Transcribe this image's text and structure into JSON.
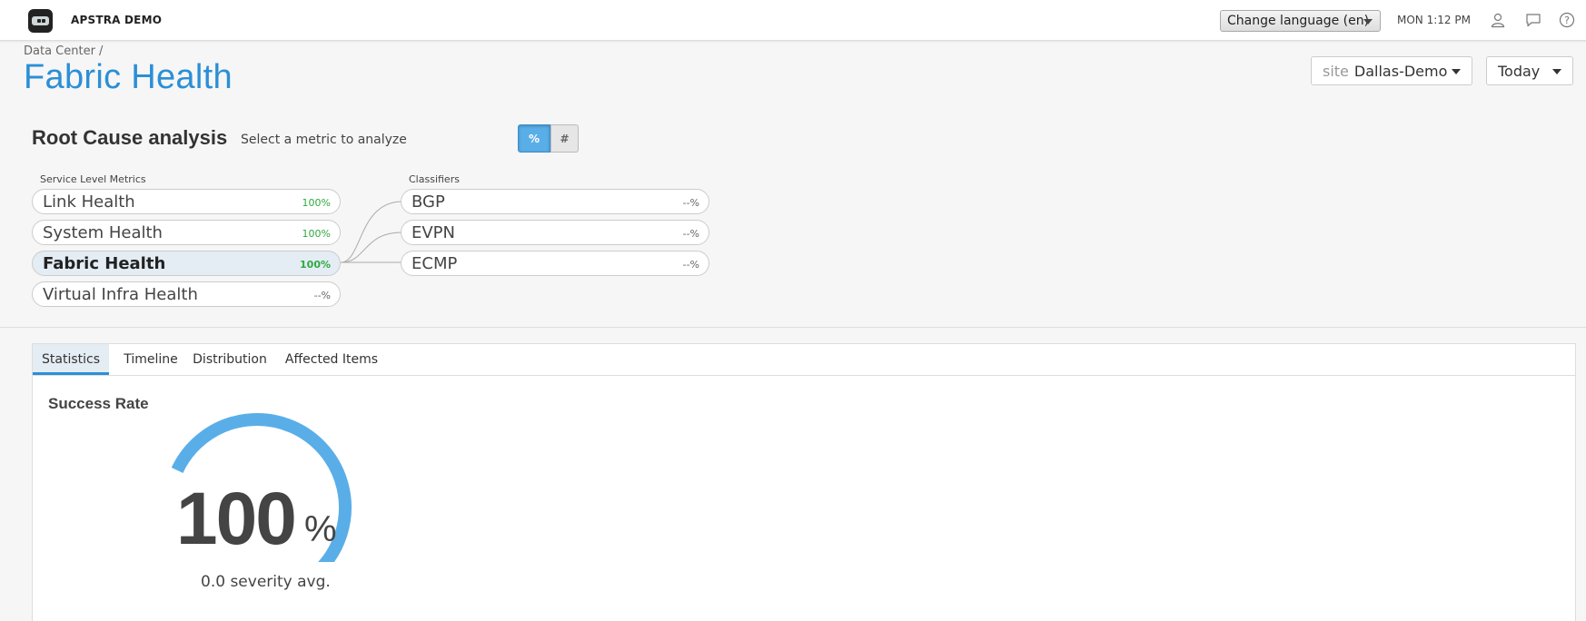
{
  "app": {
    "title": "APSTRA DEMO"
  },
  "topbar": {
    "language_select": "Change language (en)",
    "clock": "MON 1:12 PM",
    "icons": [
      "user-icon",
      "chat-icon",
      "help-icon"
    ]
  },
  "breadcrumb": "Data Center /",
  "page_title": "Fabric Health",
  "filters": {
    "site_label": "site",
    "site_value": "Dallas-Demo",
    "period": "Today"
  },
  "rca": {
    "title": "Root Cause analysis",
    "subtitle": "Select a metric to analyze",
    "toggle_pct": "%",
    "toggle_count": "#",
    "service_header": "Service Level Metrics",
    "classifier_header": "Classifiers",
    "service_metrics": [
      {
        "name": "Link Health",
        "value": "100%"
      },
      {
        "name": "System Health",
        "value": "100%"
      },
      {
        "name": "Fabric Health",
        "value": "100%"
      },
      {
        "name": "Virtual Infra Health",
        "value": "--%"
      }
    ],
    "classifiers": [
      {
        "name": "BGP",
        "value": "--%"
      },
      {
        "name": "EVPN",
        "value": "--%"
      },
      {
        "name": "ECMP",
        "value": "--%"
      }
    ]
  },
  "tabs": [
    "Statistics",
    "Timeline",
    "Distribution",
    "Affected Items"
  ],
  "statistics": {
    "title": "Success Rate",
    "value": "100",
    "unit": "%",
    "severity": "0.0 severity avg.",
    "gauge_fraction": 1.0
  },
  "colors": {
    "accent": "#2b8fd6",
    "gauge": "#5aaee8",
    "good": "#2eaa3e"
  }
}
